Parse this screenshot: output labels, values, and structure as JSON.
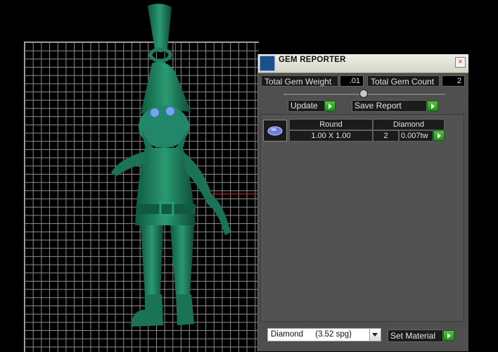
{
  "panel": {
    "title": "GEM REPORTER",
    "close": "×",
    "total_weight_label": "Total Gem Weight",
    "total_weight_value": ".01",
    "total_count_label": "Total Gem Count",
    "total_count_value": "2",
    "update_label": "Update",
    "save_label": "Save Report"
  },
  "gem_row": {
    "shape": "Round",
    "size": "1.00 X 1.00",
    "material": "Diamond",
    "count": "2",
    "weight": "0.007tw"
  },
  "material_select": {
    "value": "Diamond",
    "spg": "(3.52 spg)"
  },
  "set_material_label": "Set Material",
  "colors": {
    "model_green": "#1f7d5d",
    "axis_blue": "#2a7ad8",
    "axis_red": "#d21e1e",
    "play_green": "#33b52a"
  }
}
